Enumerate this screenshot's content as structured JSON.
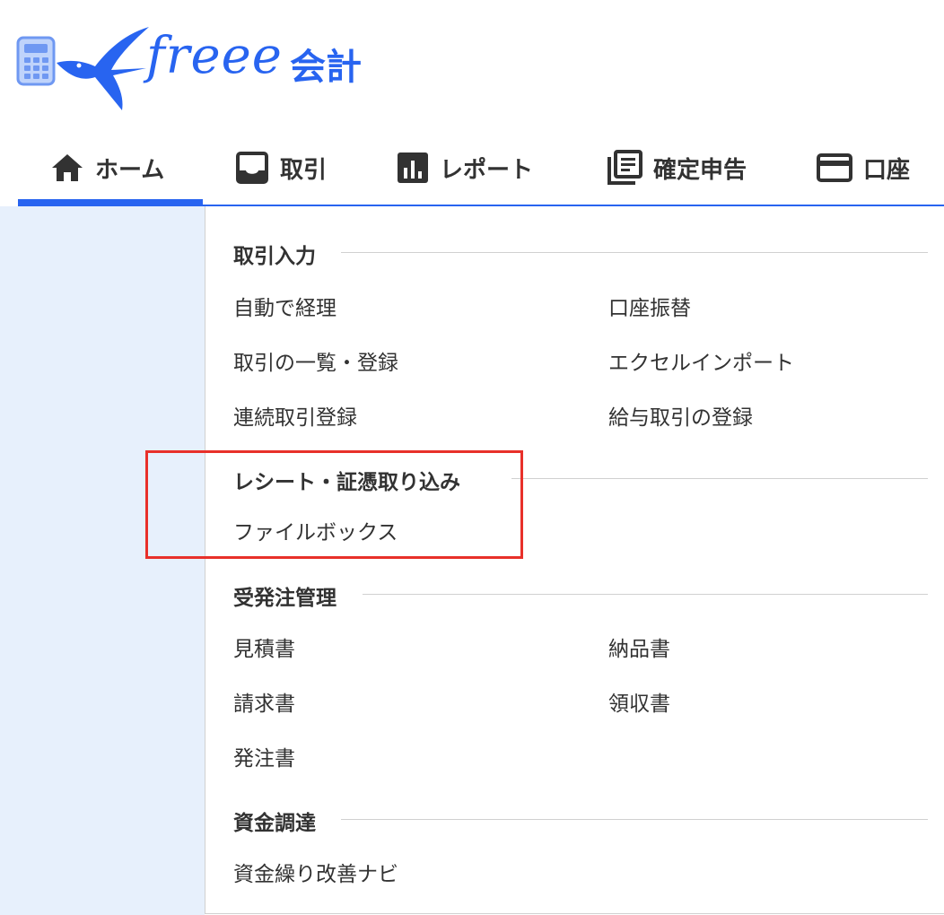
{
  "logo": {
    "text": "freee",
    "suffix": "会計"
  },
  "nav": {
    "items": [
      {
        "label": "ホーム",
        "icon": "home-icon",
        "active": true
      },
      {
        "label": "取引",
        "icon": "inbox-icon",
        "active": false
      },
      {
        "label": "レポート",
        "icon": "bar-chart-icon",
        "active": false
      },
      {
        "label": "確定申告",
        "icon": "document-stack-icon",
        "active": false
      },
      {
        "label": "口座",
        "icon": "credit-card-icon",
        "active": false
      }
    ]
  },
  "menu": {
    "sections": [
      {
        "title": "取引入力",
        "links": [
          "自動で経理",
          "口座振替",
          "取引の一覧・登録",
          "エクセルインポート",
          "連続取引登録",
          "給与取引の登録"
        ]
      },
      {
        "title": "レシート・証憑取り込み",
        "links": [
          "ファイルボックス"
        ]
      },
      {
        "title": "受発注管理",
        "links": [
          "見積書",
          "納品書",
          "請求書",
          "領収書",
          "発注書"
        ]
      },
      {
        "title": "資金調達",
        "links": [
          "資金繰り改善ナビ"
        ]
      }
    ]
  },
  "colors": {
    "brand": "#2864f0",
    "highlight": "#e8302a",
    "sidebar": "#e7f0fc"
  }
}
